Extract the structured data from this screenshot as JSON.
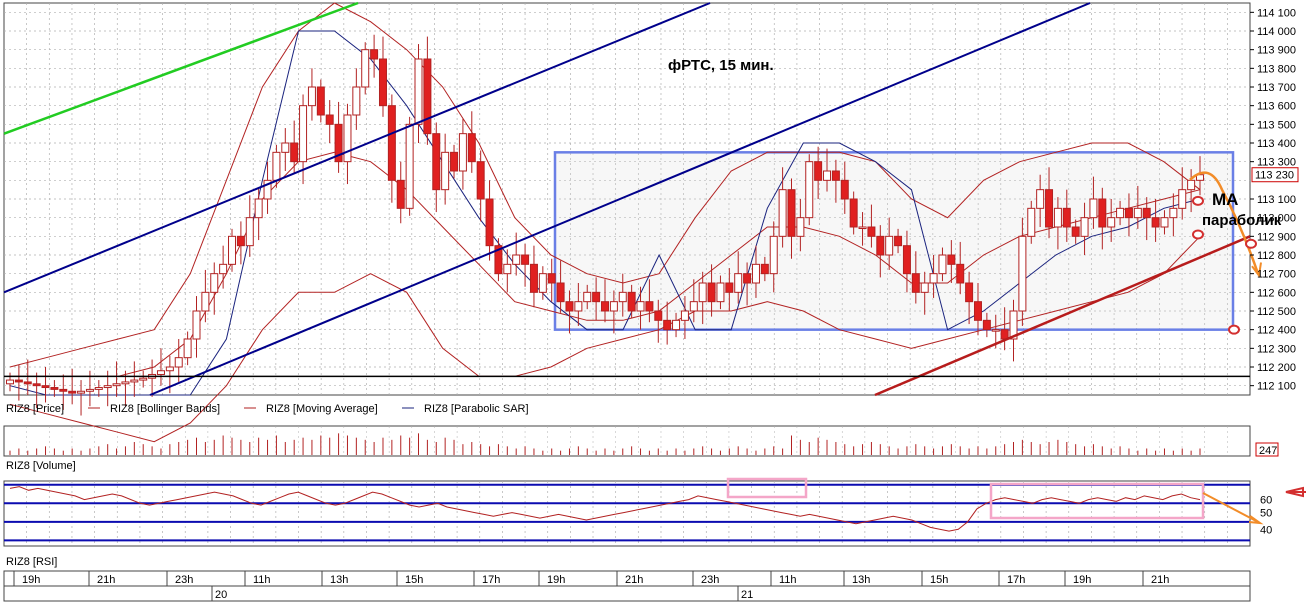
{
  "chart_data": [
    {
      "type": "candlestick",
      "title": "фРТС, 15 мин.",
      "ylim": [
        112050,
        114150
      ],
      "y_ticks": [
        "114 100",
        "114 000",
        "113 900",
        "113 800",
        "113 700",
        "113 600",
        "113 500",
        "113 400",
        "113 300",
        "113 100",
        "113 000",
        "112 900",
        "112 800",
        "112 700",
        "112 600",
        "112 500",
        "112 400",
        "112 300",
        "112 200",
        "112 100"
      ],
      "last_price": "113 230",
      "legend": [
        {
          "label": "RIZ8 [Price]"
        },
        {
          "label": "RIZ8 [Bollinger Bands]",
          "color": "#b22222"
        },
        {
          "label": "RIZ8 [Moving Average]",
          "color": "#b22222"
        },
        {
          "label": "RIZ8 [Parabolic SAR]",
          "color": "#1a237e"
        }
      ],
      "annotations": [
        "МА",
        "параболик"
      ],
      "close": [
        112130,
        112120,
        112110,
        112100,
        112090,
        112080,
        112070,
        112060,
        112070,
        112080,
        112090,
        112100,
        112110,
        112120,
        112130,
        112140,
        112160,
        112180,
        112200,
        112250,
        112350,
        112500,
        112600,
        112700,
        112750,
        112900,
        112850,
        113000,
        113100,
        113200,
        113350,
        113400,
        113300,
        113600,
        113700,
        113550,
        113500,
        113300,
        113550,
        113700,
        113900,
        113850,
        113600,
        113200,
        113050,
        113500,
        113850,
        113450,
        113150,
        113350,
        113250,
        113450,
        113300,
        113100,
        112850,
        112700,
        112750,
        112800,
        112750,
        112600,
        112700,
        112650,
        112550,
        112500,
        112550,
        112600,
        112550,
        112500,
        112550,
        112600,
        112500,
        112550,
        112500,
        112450,
        112400,
        112450,
        112500,
        112550,
        112650,
        112550,
        112650,
        112600,
        112700,
        112650,
        112750,
        112700,
        112900,
        113150,
        112900,
        113000,
        113300,
        113200,
        113250,
        113200,
        113100,
        112950,
        112950,
        112900,
        112800,
        112900,
        112850,
        112700,
        112600,
        112650,
        112700,
        112800,
        112750,
        112650,
        112550,
        112450,
        112400,
        112400,
        112350,
        112500,
        112900,
        113050,
        113150,
        112950,
        113050,
        112950,
        112900,
        113000,
        113100,
        112950,
        113000,
        113050,
        113000,
        113050,
        113000,
        112950,
        113000,
        113050,
        113150,
        113200,
        113230
      ],
      "series": [
        {
          "name": "RIZ8 [Bollinger Bands]",
          "upper": [
            112200,
            112250,
            112300,
            112350,
            112400,
            112700,
            113200,
            113700,
            114000,
            114150,
            114050,
            113900,
            113700,
            113400,
            113000,
            112800,
            112700,
            112650,
            112700,
            113000,
            113250,
            113350,
            113350,
            113350,
            113300,
            113100,
            113000,
            113200,
            113300,
            113350,
            113400,
            113400,
            113300,
            113150
          ],
          "lower": [
            112000,
            111950,
            111900,
            111850,
            111800,
            111900,
            112100,
            112400,
            112600,
            112600,
            112700,
            112600,
            112300,
            112150,
            112150,
            112200,
            112300,
            112350,
            112400,
            112500,
            112500,
            112550,
            112500,
            112400,
            112350,
            112300,
            112350,
            112400,
            112450,
            112500,
            112550,
            112600,
            112700,
            112900
          ]
        },
        {
          "name": "RIZ8 [Moving Average]",
          "values": [
            112150,
            112150,
            112150,
            112150,
            112200,
            112350,
            112700,
            113100,
            113300,
            113350,
            113300,
            113150,
            112950,
            112750,
            112550,
            112500,
            112450,
            112450,
            112500,
            112650,
            112800,
            112950,
            112950,
            112900,
            112800,
            112650,
            112650,
            112800,
            112900,
            112950,
            113000,
            113050,
            113100,
            113150
          ]
        },
        {
          "name": "RIZ8 [Parabolic SAR]",
          "values": [
            112100,
            112050,
            112050,
            112050,
            112050,
            112050,
            112350,
            113200,
            114000,
            114000,
            113850,
            113600,
            113300,
            113000,
            112750,
            112550,
            112400,
            112400,
            112800,
            112400,
            112400,
            113050,
            113400,
            113400,
            113300,
            113150,
            112400,
            112500,
            112650,
            112800,
            112900,
            112950,
            113050,
            113100
          ]
        }
      ],
      "x_ticks": [
        "19h",
        "21h",
        "23h",
        "11h",
        "13h",
        "15h",
        "17h",
        "19h",
        "21h",
        "23h",
        "11h",
        "13h",
        "15h",
        "17h",
        "19h",
        "21h"
      ],
      "date_labels": [
        "20",
        "21"
      ]
    },
    {
      "type": "bar",
      "title": "RIZ8 [Volume]",
      "last_value": "247",
      "values": [
        2,
        3,
        2,
        3,
        4,
        3,
        2,
        3,
        2,
        3,
        4,
        5,
        3,
        4,
        6,
        5,
        4,
        3,
        5,
        6,
        7,
        8,
        6,
        7,
        9,
        8,
        7,
        6,
        8,
        7,
        9,
        6,
        7,
        8,
        7,
        9,
        8,
        10,
        9,
        8,
        7,
        6,
        8,
        7,
        9,
        8,
        10,
        7,
        6,
        8,
        7,
        5,
        6,
        5,
        4,
        5,
        4,
        3,
        4,
        3,
        2,
        3,
        2,
        3,
        4,
        3,
        2,
        3,
        2,
        3,
        4,
        3,
        2,
        3,
        2,
        3,
        2,
        3,
        4,
        3,
        2,
        3,
        4,
        3,
        2,
        3,
        4,
        3,
        9,
        7,
        6,
        8,
        7,
        6,
        5,
        4,
        5,
        6,
        5,
        4,
        3,
        4,
        5,
        4,
        3,
        4,
        5,
        4,
        3,
        4,
        3,
        4,
        5,
        6,
        7,
        6,
        5,
        6,
        7,
        6,
        5,
        4,
        5,
        4,
        3,
        4,
        3,
        2,
        3,
        2,
        3,
        2,
        3,
        2,
        3
      ]
    },
    {
      "type": "line",
      "title": "RIZ8 [RSI]",
      "y_ticks": [
        "60",
        "50",
        "40"
      ],
      "levels": [
        68,
        58,
        48,
        38
      ],
      "values": [
        66,
        67,
        65,
        66,
        65,
        64,
        63,
        62,
        60,
        61,
        62,
        63,
        62,
        60,
        58,
        57,
        58,
        59,
        60,
        61,
        62,
        63,
        64,
        63,
        62,
        60,
        58,
        57,
        59,
        61,
        63,
        64,
        62,
        60,
        58,
        57,
        58,
        60,
        62,
        64,
        63,
        61,
        59,
        57,
        56,
        57,
        58,
        56,
        55,
        54,
        53,
        52,
        51,
        52,
        53,
        52,
        51,
        50,
        51,
        52,
        51,
        50,
        49,
        50,
        51,
        52,
        53,
        54,
        55,
        56,
        57,
        58,
        59,
        60,
        62,
        61,
        60,
        59,
        58,
        57,
        56,
        55,
        54,
        53,
        52,
        51,
        52,
        51,
        50,
        49,
        48,
        47,
        48,
        49,
        50,
        51,
        50,
        49,
        47,
        45,
        44,
        43,
        44,
        48,
        55,
        58,
        60,
        61,
        60,
        59,
        58,
        60,
        61,
        60,
        59,
        58,
        60,
        61,
        60,
        59,
        61,
        60,
        62,
        61,
        60,
        62,
        63,
        61,
        60
      ],
      "ylim": [
        35,
        70
      ]
    }
  ],
  "time_axis": {
    "hours": [
      "19h",
      "21h",
      "23h",
      "11h",
      "13h",
      "15h",
      "17h",
      "19h",
      "21h",
      "23h",
      "11h",
      "13h",
      "15h",
      "17h",
      "19h",
      "21h"
    ],
    "days": [
      "20",
      "21"
    ]
  },
  "colors": {
    "bull": "#ffffff",
    "bear": "#e02020",
    "wick": "#b22222",
    "band": "#b22222",
    "sar": "#1a237e",
    "channel": "#00008b",
    "green_line": "#22cc22",
    "support": "#b71c1c",
    "box": "#6a7fe6",
    "pink": "#f4a6c8",
    "orange": "#f28c28",
    "grid": "#b0b0b0"
  }
}
